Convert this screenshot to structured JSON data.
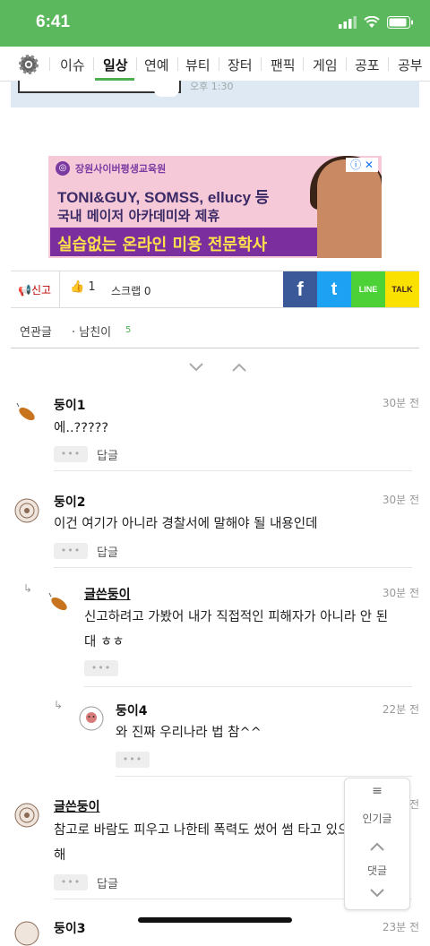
{
  "status": {
    "time": "6:41"
  },
  "tabs": [
    "이슈",
    "일상",
    "연예",
    "뷰티",
    "장터",
    "팬픽",
    "게임",
    "공포",
    "공부"
  ],
  "active_tab": "일상",
  "post_card": {
    "time": "오후 1:30"
  },
  "ad": {
    "brand": "장원사이버평생교육원",
    "line1": "TONI&GUY, SOMSS, ellucy 등",
    "line2": "국내 메이저 아카데미와 제휴",
    "line3": "실습없는 온라인 미용 전문학사"
  },
  "actions": {
    "report": "신고",
    "like_count": "1",
    "scrap": "스크랩 0",
    "sns": [
      "f",
      "t",
      "LINE",
      "TALK"
    ]
  },
  "related": {
    "label": "연관글",
    "tag": "남친이",
    "count": "5"
  },
  "comments": [
    {
      "nick": "둥이1",
      "time": "30분 전",
      "text": [
        "에..?????"
      ],
      "reply": "답글",
      "more": "•••"
    },
    {
      "nick": "둥이2",
      "time": "30분 전",
      "text": [
        "이건 여기가 아니라 경찰서에 말해야 될 내용인데"
      ],
      "reply": "답글",
      "more": "•••"
    },
    {
      "nick": "글쓴둥이",
      "time": "30분 전",
      "text": [
        "신고하려고 가봤어 내가 직접적인 피해자가 아니라 안 된",
        "대 ㅎㅎ"
      ],
      "more": "•••"
    },
    {
      "nick": "둥이4",
      "time": "22분 전",
      "text": [
        "와 진짜 우리나라 법 참^^"
      ],
      "more": "•••"
    },
    {
      "nick": "글쓴둥이",
      "time": "27분 전",
      "text": [
        "참고로 바람도 피우고 나한테 폭력도 썼어 썸 타고 있으면 조심",
        "해"
      ],
      "reply": "답글",
      "more": "•••"
    },
    {
      "nick": "둥이3",
      "time": "23분 전"
    }
  ],
  "floatnav": {
    "popular": "인기글",
    "comments": "댓글"
  }
}
